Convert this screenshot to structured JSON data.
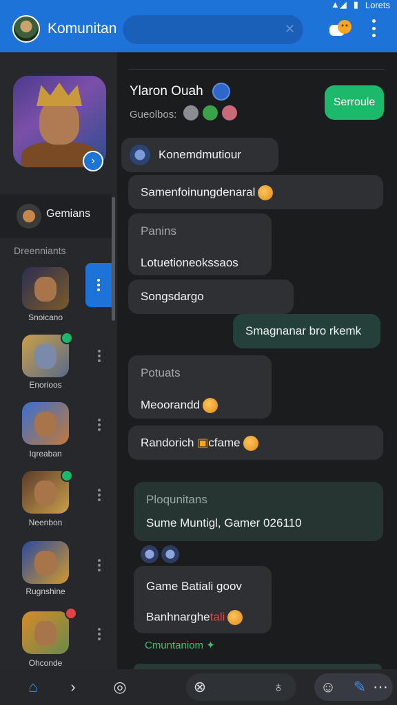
{
  "status": {
    "right_text": "Lorets"
  },
  "appbar": {
    "title": "Komunitan",
    "search_placeholder": ""
  },
  "sidebar": {
    "games_label": "Gemians",
    "section_label": "Dreenniants",
    "items": [
      {
        "label": "Snoicano"
      },
      {
        "label": "Enorioos"
      },
      {
        "label": "Iqreaban"
      },
      {
        "label": "Neenbon"
      },
      {
        "label": "Rugnshine"
      },
      {
        "label": "Ohconde"
      }
    ]
  },
  "chat": {
    "title": "Ylaron Ouah",
    "sub_label": "Gueolbos:",
    "action_button": "Serroule",
    "messages": [
      {
        "text": "Konemdmutiour"
      },
      {
        "text": "Samenfoinungdenaral"
      },
      {
        "text": "Panins"
      },
      {
        "text": "Lotuetioneokssaos"
      },
      {
        "text": "Songsdargo"
      },
      {
        "text": "Smagnanar bro rkemk"
      },
      {
        "text": "Potuats"
      },
      {
        "text": "Meoorandd"
      },
      {
        "text": "Randorich"
      },
      {
        "text": "cfame"
      },
      {
        "text": "Ploqunitans"
      },
      {
        "text": "Sume Muntigl, Gamer 026110"
      },
      {
        "text": "Game Batiali goov"
      },
      {
        "text": "Banhnarghe"
      },
      {
        "text": "tali"
      }
    ],
    "footer_link": "Cmuntaniom"
  },
  "colors": {
    "accent": "#1e73d8",
    "green": "#1db96a",
    "bg": "#1b1c1e"
  }
}
